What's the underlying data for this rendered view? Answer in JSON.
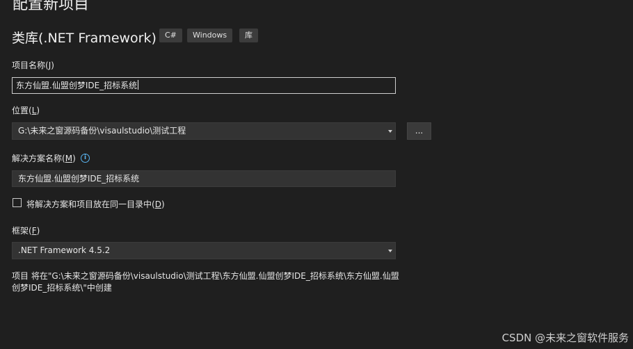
{
  "page_title": "配置新项目",
  "template": {
    "name": "类库(.NET Framework)",
    "tags": [
      "C#",
      "Windows",
      "库"
    ]
  },
  "project_name": {
    "label": "项目名称",
    "accel": "J",
    "value": "东方仙盟.仙盟创梦IDE_招标系统"
  },
  "location": {
    "label": "位置",
    "accel": "L",
    "value": "G:\\未来之窗源码备份\\visaulstudio\\测试工程",
    "browse_label": "..."
  },
  "solution_name": {
    "label": "解决方案名称",
    "accel": "M",
    "value": "东方仙盟.仙盟创梦IDE_招标系统",
    "info_icon": "info-icon"
  },
  "same_dir": {
    "label": "将解决方案和项目放在同一目录中",
    "accel": "D",
    "checked": false
  },
  "framework": {
    "label": "框架",
    "accel": "F",
    "value": ".NET Framework 4.5.2"
  },
  "creation_info": "项目 将在\"G:\\未来之窗源码备份\\visaulstudio\\测试工程\\东方仙盟.仙盟创梦IDE_招标系统\\东方仙盟.仙盟创梦IDE_招标系统\\\"中创建",
  "watermark": "CSDN @未来之窗软件服务",
  "colors": {
    "background": "#1f1f1f",
    "input_background": "#333333",
    "info_icon": "#5ab4f0"
  }
}
